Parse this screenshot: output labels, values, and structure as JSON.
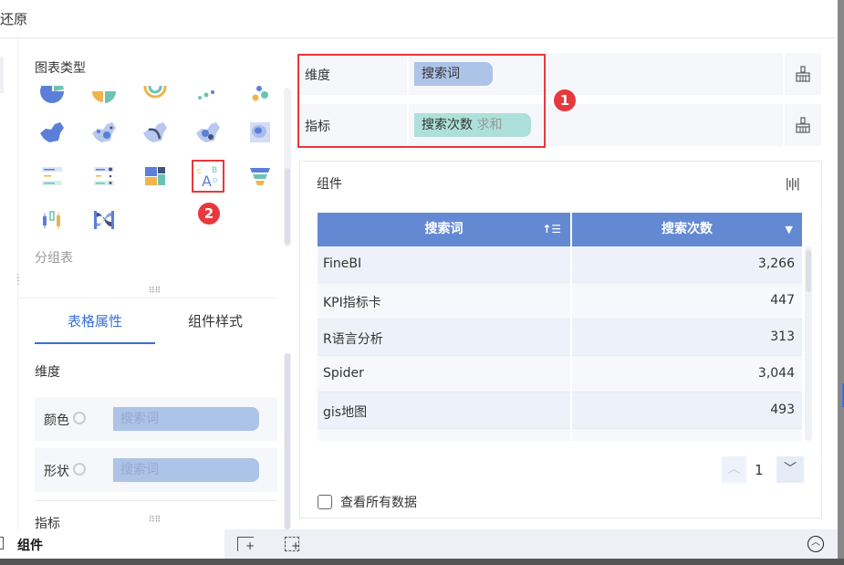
{
  "topbar": {
    "restore_label": "还原"
  },
  "chart_types": {
    "title": "图表类型",
    "group_label": "分组表",
    "icons": [
      "pie-chart-icon",
      "rose-chart-icon",
      "multi-ring-icon",
      "scatter-icon",
      "bubble-icon",
      "region-map-icon",
      "point-map-icon",
      "flow-map-icon",
      "heat-map-icon",
      "contour-map-icon",
      "ranking-list-icon",
      "dot-list-icon",
      "treemap-icon",
      "word-cloud-icon",
      "funnel-icon",
      "candlestick-icon",
      "sankey-icon"
    ],
    "selected": "word-cloud-icon"
  },
  "annotations": {
    "badge1": "1",
    "badge2": "2",
    "color": "#e8383d"
  },
  "tabs": [
    {
      "label": "表格属性",
      "active": true
    },
    {
      "label": "组件样式",
      "active": false
    }
  ],
  "properties": {
    "dimension_title": "维度",
    "rows": [
      {
        "label": "颜色",
        "value": "搜索词"
      },
      {
        "label": "形状",
        "value": "搜索词"
      }
    ],
    "metric_title": "指标"
  },
  "fields": {
    "dimension": {
      "label": "维度",
      "chip": "搜索词"
    },
    "metric": {
      "label": "指标",
      "chip": "搜索次数",
      "agg": "求和"
    }
  },
  "widget": {
    "title": "组件",
    "columns": [
      "搜索词",
      "搜索次数"
    ],
    "rows": [
      [
        "FineBI",
        "3,266"
      ],
      [
        "KPI指标卡",
        "447"
      ],
      [
        "R语言分析",
        "313"
      ],
      [
        "Spider",
        "3,044"
      ],
      [
        "gis地图",
        "493"
      ]
    ],
    "page": "1",
    "view_all_label": "查看所有数据",
    "view_all_checked": false
  },
  "bottombar": {
    "tab_label": "组件"
  },
  "colors": {
    "accent": "#3a6fd8",
    "header": "#6489d3",
    "dimension_chip": "#aec3e8",
    "metric_chip": "#ade0da"
  }
}
